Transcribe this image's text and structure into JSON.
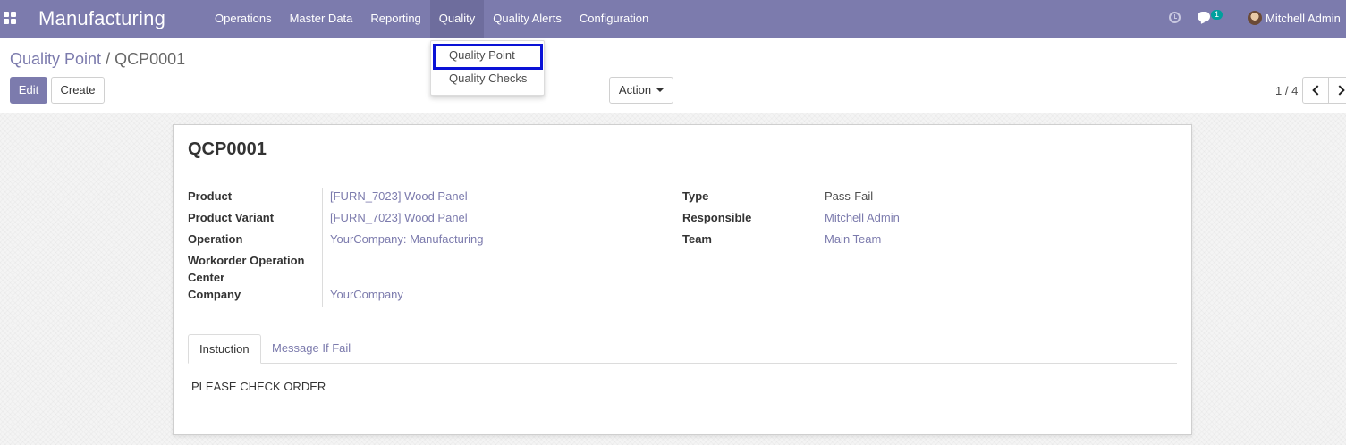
{
  "navbar": {
    "app_name": "Manufacturing",
    "menu": [
      {
        "label": "Operations"
      },
      {
        "label": "Master Data"
      },
      {
        "label": "Reporting"
      },
      {
        "label": "Quality"
      },
      {
        "label": "Quality Alerts"
      },
      {
        "label": "Configuration"
      }
    ],
    "active_menu": "Quality",
    "messages_count": "1",
    "user_name": "Mitchell Admin",
    "bar_color": "#7c7bad",
    "icons": [
      "apps-icon",
      "clock-icon",
      "chat-icon",
      "avatar"
    ]
  },
  "dropdown": {
    "items": [
      {
        "label": "Quality Point"
      },
      {
        "label": "Quality Checks"
      }
    ],
    "highlighted_item": "Quality Point",
    "highlight_color": "#0a12d6"
  },
  "control_panel": {
    "breadcrumb_parent": "Quality Point",
    "breadcrumb_sep": "/",
    "breadcrumb_current": "QCP0001",
    "edit_label": "Edit",
    "create_label": "Create",
    "action_label": "Action",
    "pager_text": "1 / 4"
  },
  "record": {
    "title": "QCP0001",
    "left_fields": [
      {
        "label": "Product",
        "value": "[FURN_7023] Wood Panel"
      },
      {
        "label": "Product Variant",
        "value": "[FURN_7023] Wood Panel"
      },
      {
        "label": "Operation",
        "value": "YourCompany: Manufacturing"
      },
      {
        "label": "Workorder Operation",
        "label2": "Center",
        "value": ""
      },
      {
        "label": "Company",
        "value": "YourCompany"
      }
    ],
    "right_fields": [
      {
        "label": "Type",
        "value": "Pass-Fail"
      },
      {
        "label": "Responsible",
        "value": "Mitchell Admin"
      },
      {
        "label": "Team",
        "value": "Main Team"
      }
    ],
    "tabs": [
      {
        "label": "Instuction"
      },
      {
        "label": "Message If Fail"
      }
    ],
    "active_tab": "Instuction",
    "instruction_text": "PLEASE CHECK ORDER"
  }
}
